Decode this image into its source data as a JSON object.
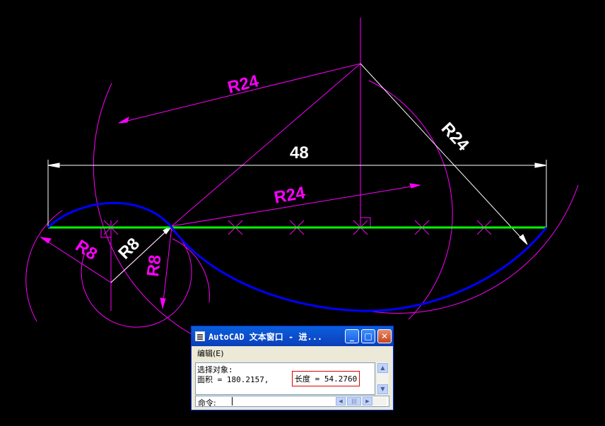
{
  "drawing": {
    "dimensions": {
      "horizontal": "48",
      "radius_upper_left": "R24",
      "radius_upper_right": "R24",
      "radius_middle": "R24",
      "small_radius_left": "R8",
      "small_radius_center": "R8",
      "small_radius_right": "R8"
    },
    "colors": {
      "background": "#000000",
      "construction": "#ff00ff",
      "dimension": "#ffffff",
      "baseline": "#00ff00",
      "profile_arc": "#0000ff"
    }
  },
  "text_window": {
    "title": "AutoCAD 文本窗口 - 进...",
    "buttons": {
      "minimize": "_",
      "maximize": "□",
      "close": "✕"
    },
    "menu": {
      "edit": "编辑(E)"
    },
    "output": {
      "line1": "选择对象:",
      "line2": "面积 = 180.2157,",
      "length_highlight": "长度 = 54.2760"
    },
    "command_prompt": "命令:"
  }
}
